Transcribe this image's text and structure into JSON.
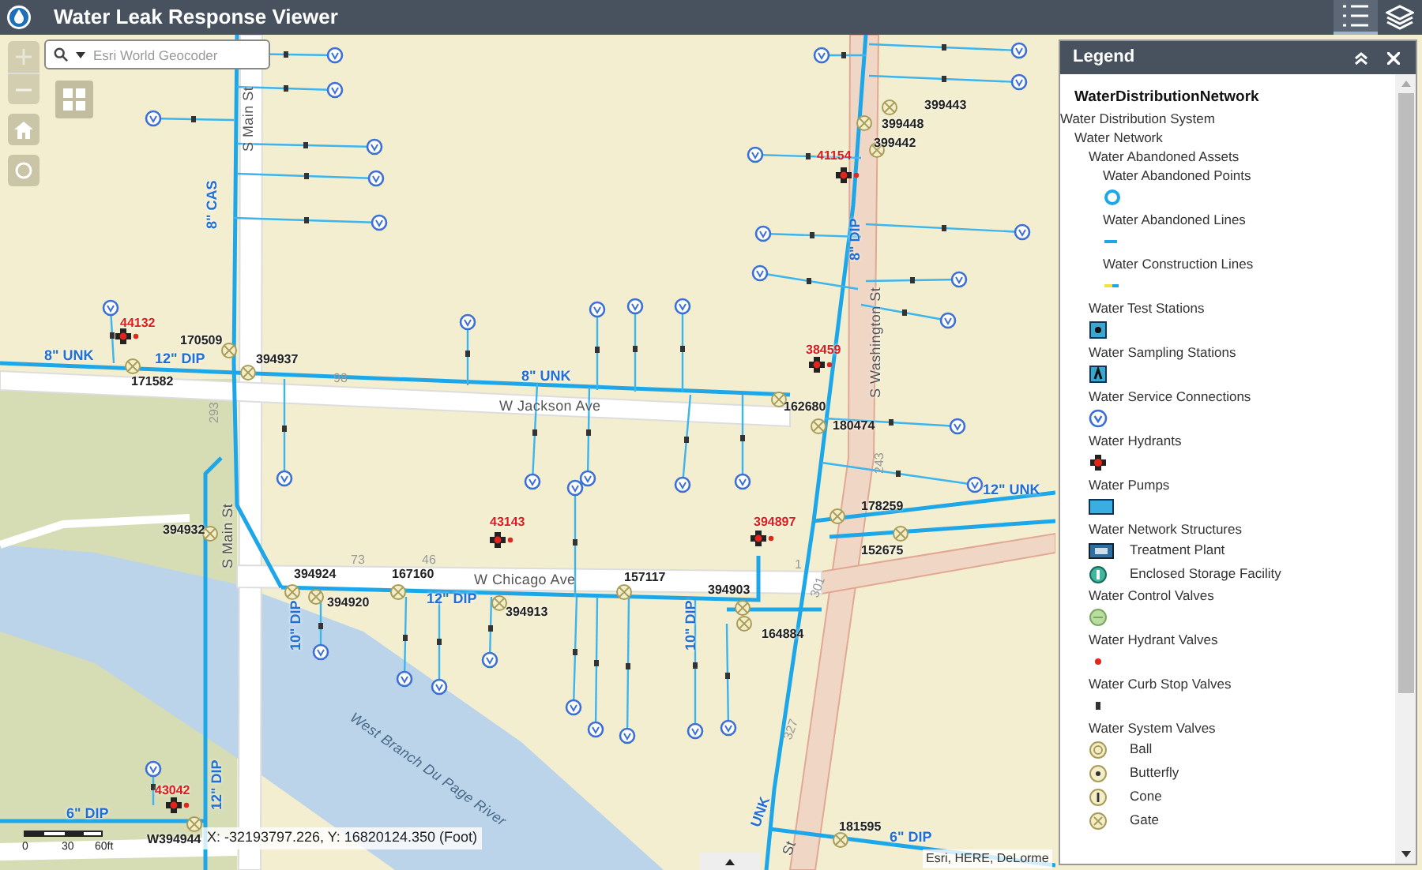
{
  "app": {
    "title": "Water Leak Response Viewer"
  },
  "toolbar": [
    {
      "kind": "legend",
      "selected": true
    },
    {
      "kind": "layers",
      "selected": false
    }
  ],
  "search": {
    "placeholder": "Esri World Geocoder"
  },
  "map": {
    "labels": [
      {
        "text": "S Main St",
        "kind": "street"
      },
      {
        "text": "8\" CAS",
        "kind": "pipe"
      },
      {
        "text": "41154",
        "kind": "hydrant"
      },
      {
        "text": "399443",
        "kind": "asset"
      },
      {
        "text": "399448",
        "kind": "asset"
      },
      {
        "text": "399442",
        "kind": "asset"
      },
      {
        "text": "8\" DIP",
        "kind": "pipe"
      },
      {
        "text": "S Washington St",
        "kind": "street"
      },
      {
        "text": "38459",
        "kind": "hydrant"
      },
      {
        "text": "162680",
        "kind": "asset"
      },
      {
        "text": "180474",
        "kind": "asset"
      },
      {
        "text": "44132",
        "kind": "hydrant"
      },
      {
        "text": "170509",
        "kind": "asset"
      },
      {
        "text": "8\" UNK",
        "kind": "pipe"
      },
      {
        "text": "12\" DIP",
        "kind": "pipe"
      },
      {
        "text": "171582",
        "kind": "asset"
      },
      {
        "text": "394937",
        "kind": "asset"
      },
      {
        "text": "98",
        "kind": "road-number"
      },
      {
        "text": "8\" UNK",
        "kind": "pipe"
      },
      {
        "text": "W Jackson Ave",
        "kind": "street"
      },
      {
        "text": "293",
        "kind": "road-number"
      },
      {
        "text": "243",
        "kind": "road-number"
      },
      {
        "text": "178259",
        "kind": "asset"
      },
      {
        "text": "12\" UNK",
        "kind": "pipe"
      },
      {
        "text": "152675",
        "kind": "asset"
      },
      {
        "text": "394932",
        "kind": "asset"
      },
      {
        "text": "43143",
        "kind": "hydrant"
      },
      {
        "text": "394897",
        "kind": "hydrant"
      },
      {
        "text": "S Main St",
        "kind": "street"
      },
      {
        "text": "73",
        "kind": "road-number"
      },
      {
        "text": "46",
        "kind": "road-number"
      },
      {
        "text": "1",
        "kind": "road-number"
      },
      {
        "text": "394924",
        "kind": "asset"
      },
      {
        "text": "167160",
        "kind": "asset"
      },
      {
        "text": "W Chicago Ave",
        "kind": "street"
      },
      {
        "text": "12\" DIP",
        "kind": "pipe"
      },
      {
        "text": "157117",
        "kind": "asset"
      },
      {
        "text": "394903",
        "kind": "asset"
      },
      {
        "text": "394920",
        "kind": "asset"
      },
      {
        "text": "394913",
        "kind": "asset"
      },
      {
        "text": "10\" DIP",
        "kind": "pipe"
      },
      {
        "text": "10\" DIP",
        "kind": "pipe"
      },
      {
        "text": "164884",
        "kind": "asset"
      },
      {
        "text": "301",
        "kind": "road-number"
      },
      {
        "text": "West Branch Du Page River",
        "kind": "river"
      },
      {
        "text": "327",
        "kind": "road-number"
      },
      {
        "text": "43042",
        "kind": "hydrant"
      },
      {
        "text": "12\" DIP",
        "kind": "pipe"
      },
      {
        "text": "6\" DIP",
        "kind": "pipe"
      },
      {
        "text": "181595",
        "kind": "asset"
      },
      {
        "text": "6\" DIP",
        "kind": "pipe"
      },
      {
        "text": "UNK",
        "kind": "pipe"
      },
      {
        "text": "St",
        "kind": "street"
      },
      {
        "text": "W394944",
        "kind": "asset"
      }
    ],
    "coordinates": "X: -32193797.226, Y: 16820124.350 (Foot)",
    "scale": [
      "0",
      "30",
      "60ft"
    ],
    "attribution": "Esri, HERE, DeLorme"
  },
  "legend": {
    "title": "Legend",
    "layer": "WaterDistributionNetwork",
    "tree": [
      {
        "label": "Water Distribution System",
        "children": [
          {
            "label": "Water Network",
            "children": [
              {
                "label": "Water Abandoned Assets",
                "children": [
                  {
                    "label": "Water Abandoned Points",
                    "kind": "ring"
                  },
                  {
                    "label": "Water Abandoned Lines",
                    "kind": "line"
                  },
                  {
                    "label": "Water Construction Lines",
                    "kind": "construction-line"
                  }
                ]
              },
              {
                "label": "Water Test Stations",
                "kind": "test-station"
              },
              {
                "label": "Water Sampling Stations",
                "kind": "sampling-station"
              },
              {
                "label": "Water Service Connections",
                "kind": "meter"
              },
              {
                "label": "Water Hydrants",
                "kind": "hydrant"
              },
              {
                "label": "Water Pumps",
                "kind": "pump"
              },
              {
                "label": "Water Network Structures",
                "classes": [
                  {
                    "label": "Treatment Plant",
                    "kind": "treatment-plant"
                  },
                  {
                    "label": "Enclosed Storage Facility",
                    "kind": "storage"
                  }
                ]
              },
              {
                "label": "Water Control Valves",
                "kind": "control-valve"
              },
              {
                "label": "Water Hydrant Valves",
                "kind": "hydrant-valve"
              },
              {
                "label": "Water Curb Stop Valves",
                "kind": "curb-stop"
              },
              {
                "label": "Water System Valves",
                "classes": [
                  {
                    "label": "Ball",
                    "kind": "ball"
                  },
                  {
                    "label": "Butterfly",
                    "kind": "butterfly"
                  },
                  {
                    "label": "Cone",
                    "kind": "cone"
                  },
                  {
                    "label": "Gate",
                    "kind": "gate"
                  }
                ]
              }
            ]
          }
        ]
      }
    ]
  }
}
